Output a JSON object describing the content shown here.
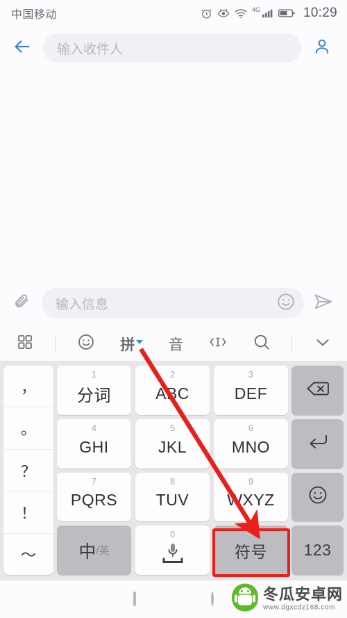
{
  "status_bar": {
    "carrier": "中国移动",
    "network_type": "4G",
    "time": "10:29",
    "icons": [
      "alarm-icon",
      "eye-icon",
      "wifi-icon",
      "signal-icon",
      "battery-icon"
    ]
  },
  "app_bar": {
    "back_icon": "back-arrow-icon",
    "recipient_placeholder": "输入收件人",
    "contacts_icon": "person-icon"
  },
  "composer": {
    "attach_icon": "paperclip-icon",
    "message_placeholder": "输入信息",
    "emoji_icon": "smiley-icon",
    "send_icon": "send-icon"
  },
  "keyboard": {
    "toolbar": [
      {
        "name": "grid-icon",
        "label": ""
      },
      {
        "name": "divider",
        "label": ""
      },
      {
        "name": "emoji-icon",
        "label": ""
      },
      {
        "name": "pinyin-mode",
        "label": "拼"
      },
      {
        "name": "voice-mode",
        "label": "音"
      },
      {
        "name": "cursor-move-icon",
        "label": ""
      },
      {
        "name": "search-icon",
        "label": ""
      },
      {
        "name": "divider",
        "label": ""
      },
      {
        "name": "collapse-keyboard-icon",
        "label": ""
      }
    ],
    "punctuation": [
      "，",
      "。",
      "？",
      "！",
      "～"
    ],
    "keys": [
      {
        "num": "1",
        "main": "分词",
        "cn": true
      },
      {
        "num": "2",
        "main": "ABC",
        "cn": false
      },
      {
        "num": "3",
        "main": "DEF",
        "cn": false
      },
      {
        "num": "4",
        "main": "GHI",
        "cn": false
      },
      {
        "num": "5",
        "main": "JKL",
        "cn": false
      },
      {
        "num": "6",
        "main": "MNO",
        "cn": false
      },
      {
        "num": "7",
        "main": "PQRS",
        "cn": false
      },
      {
        "num": "8",
        "main": "TUV",
        "cn": false
      },
      {
        "num": "9",
        "main": "WXYZ",
        "cn": false
      }
    ],
    "lang_key": {
      "primary": "中",
      "secondary": "/英"
    },
    "space_key": {
      "num": "0",
      "icon": "microphone-icon"
    },
    "symbol_key": "符号",
    "numeric_key": "123",
    "right_column": [
      {
        "name": "backspace-key",
        "label": ""
      },
      {
        "name": "enter-key",
        "label": ""
      },
      {
        "name": "emoji-key",
        "label": ""
      }
    ]
  },
  "annotation": {
    "arrow_color": "#e8201c",
    "box_color": "#e8201c",
    "target": "符号"
  },
  "nav_bar": {
    "recents_icon": "square-icon",
    "home_icon": "circle-icon"
  },
  "watermark": {
    "title": "冬瓜安卓网",
    "url": "www.dgxcdz168.com",
    "logo": "android-mascot-icon",
    "logo_color": "#5cbb2a"
  }
}
